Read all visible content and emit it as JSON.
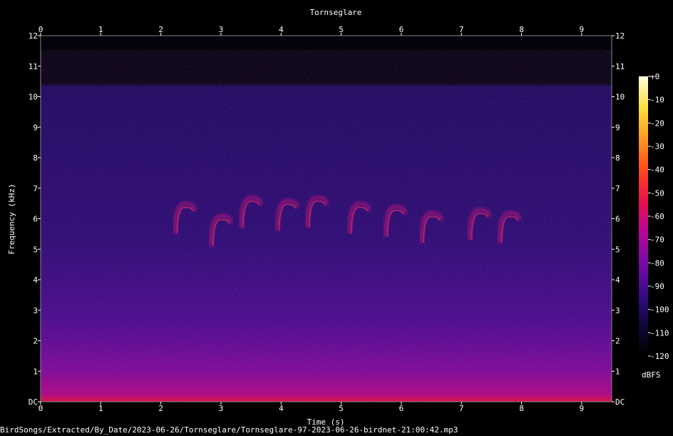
{
  "chart_data": {
    "type": "heatmap",
    "title": "Tornseglare",
    "xlabel": "Time (s)",
    "ylabel": "Frequency (kHz)",
    "xlim": [
      0,
      9.5
    ],
    "ylim": [
      0,
      12
    ],
    "x_ticks": [
      "0",
      "1",
      "2",
      "3",
      "4",
      "5",
      "6",
      "7",
      "8",
      "9"
    ],
    "y_ticks": [
      "DC",
      "1",
      "2",
      "3",
      "4",
      "5",
      "6",
      "7",
      "8",
      "9",
      "10",
      "11",
      "12"
    ],
    "colorbar": {
      "label": "dBFS",
      "range": [
        -120,
        0
      ],
      "ticks": [
        "+0",
        "-10",
        "-20",
        "-30",
        "-40",
        "-50",
        "-60",
        "-70",
        "-80",
        "-90",
        "-100",
        "-110",
        "-120"
      ],
      "colors": [
        "#000000",
        "#0c0838",
        "#3a0b8a",
        "#7a0aa8",
        "#b8059a",
        "#e8124a",
        "#ff4a1a",
        "#ff9a20",
        "#ffe040",
        "#ffffd8"
      ]
    },
    "calls": [
      {
        "t": 2.4,
        "f": 6.0
      },
      {
        "t": 3.0,
        "f": 5.6
      },
      {
        "t": 3.5,
        "f": 6.2
      },
      {
        "t": 4.1,
        "f": 6.1
      },
      {
        "t": 4.6,
        "f": 6.2
      },
      {
        "t": 5.3,
        "f": 6.0
      },
      {
        "t": 5.9,
        "f": 5.9
      },
      {
        "t": 6.5,
        "f": 5.7
      },
      {
        "t": 7.3,
        "f": 5.8
      },
      {
        "t": 7.8,
        "f": 5.7
      }
    ]
  },
  "footer": "BirdSongs/Extracted/By_Date/2023-06-26/Tornseglare/Tornseglare-97-2023-06-26-birdnet-21:00:42.mp3"
}
